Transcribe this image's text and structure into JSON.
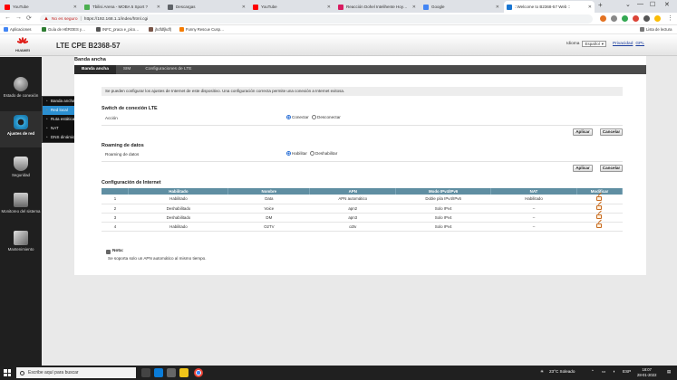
{
  "browser": {
    "tabs": [
      {
        "title": "YouTube",
        "color": "#ff0000"
      },
      {
        "title": "Tbilisi Arena - MOBA 5 Sport ?",
        "color": "#4caf50"
      },
      {
        "title": "Descargas",
        "color": "#5f6368"
      },
      {
        "title": "YouTube",
        "color": "#ff0000"
      },
      {
        "title": "Reacción Dohel Intelihente Hoy…",
        "color": "#d81b60"
      },
      {
        "title": "Google",
        "color": "#4285f4"
      },
      {
        "title": "::Welcome to B2368-57 Web ::",
        "color": "#1976d2"
      }
    ],
    "new_tab": "+",
    "window_controls": [
      "⌄",
      "—",
      "☐",
      "✕"
    ],
    "nav": [
      "←",
      "→",
      "⟳"
    ],
    "address": {
      "warning": "No es seguro",
      "url": "https://192.168.1.1/index/html.cgi"
    },
    "bookmarks": [
      {
        "label": "Aplicaciones",
        "color": "#4285f4"
      },
      {
        "label": "Guía de HÉROES y…",
        "color": "#2e7d32"
      },
      {
        "label": "INFC_praca e_pico…",
        "color": "#555555"
      },
      {
        "label": "jhdfdfjkdf)",
        "color": "#795548"
      },
      {
        "label": "Funny Rescue Cusp…",
        "color": "#f57c00"
      }
    ],
    "reading_list": "Lista de lectura"
  },
  "header": {
    "brand": "HUAWEI",
    "product": "LTE CPE B2368-57",
    "language_label": "Idioma",
    "language_value": "Español",
    "privacy": "Privacidad",
    "gpl": "GPL"
  },
  "nav": {
    "items": [
      {
        "label": "Estado de conexión"
      },
      {
        "label": "Ajustes de red"
      },
      {
        "label": "Seguridad"
      },
      {
        "label": "Monitoreo del sistema"
      },
      {
        "label": "Mantenimiento"
      }
    ],
    "flyout": [
      "Banda ancha",
      "Red local",
      "Ruta estática",
      "NAT",
      "DNS dinámico"
    ]
  },
  "page": {
    "section_title": "Banda ancha",
    "subtabs": [
      "Banda ancha",
      "SIM",
      "Configuraciones de LTE"
    ],
    "info": "Se pueden configurar los ajustes de Internet de este dispositivo. Una configuración correcta permite una conexión a Internet exitosa.",
    "lte_switch": {
      "title": "Switch de conexión LTE",
      "label": "Acción",
      "options": [
        "Conectar",
        "Desconectar"
      ]
    },
    "roaming": {
      "title": "Roaming de datos",
      "label": "Roaming de datos",
      "options": [
        "Habilitar",
        "Deshabilitar"
      ]
    },
    "buttons": {
      "apply": "Aplicar",
      "cancel": "Cancelar"
    },
    "internet": {
      "title": "Configuración de Internet",
      "columns": [
        "",
        "Habilitado",
        "Nombre",
        "APN",
        "Modo IPv4/IPv6",
        "NAT",
        "Modificar"
      ],
      "rows": [
        [
          "1",
          "Habilitado",
          "Data",
          "APN automático",
          "Doble pila IPv4/IPv6",
          "Habilitado"
        ],
        [
          "2",
          "Deshabilitado",
          "Voice",
          "apn2",
          "Solo IPv4",
          "--"
        ],
        [
          "3",
          "Deshabilitado",
          "DM",
          "apn3",
          "Solo IPv4",
          "--"
        ],
        [
          "4",
          "Habilitado",
          "O2TV",
          "o2tv",
          "Solo IPv4",
          "--"
        ]
      ]
    },
    "note": {
      "title": "Nota:",
      "text": "Se soporta solo un APN automático al mismo tiempo."
    }
  },
  "taskbar": {
    "search_placeholder": "Escribe aquí para buscar",
    "weather": "23°C  Soleado",
    "lang": "ESP",
    "time": "18:07",
    "date": "28-01-2022"
  }
}
